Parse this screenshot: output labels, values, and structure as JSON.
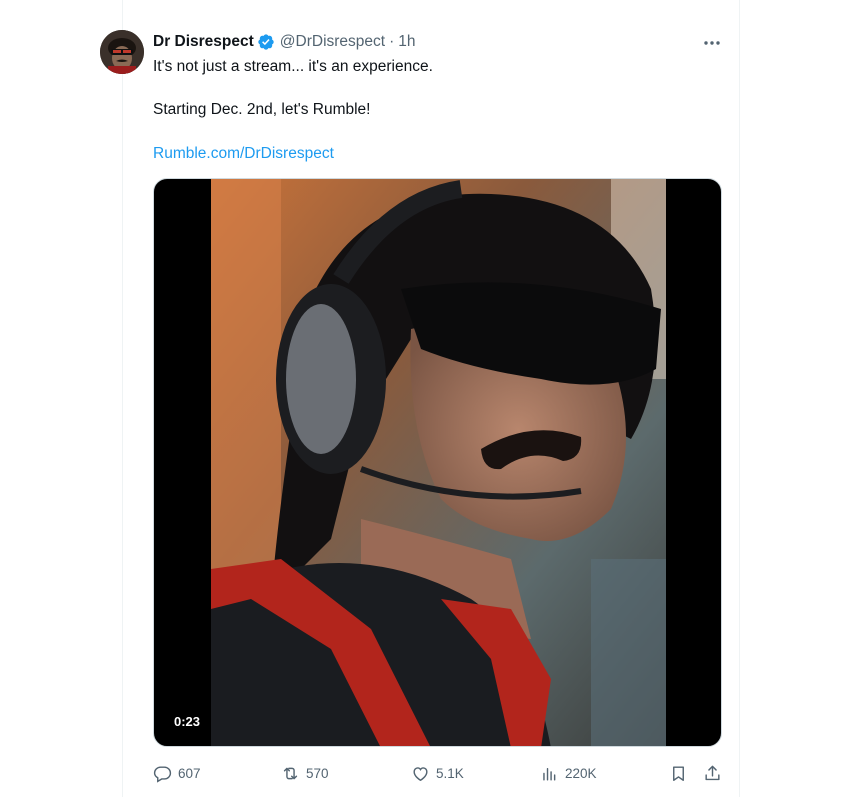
{
  "tweet": {
    "author_name": "Dr Disrespect",
    "handle": "@DrDisrespect",
    "separator": "·",
    "time": "1h",
    "text_line1": "It's not just a stream... it's an experience.",
    "text_line2": "Starting Dec. 2nd, let's Rumble!",
    "link_text": "Rumble.com/DrDisrespect"
  },
  "media": {
    "duration": "0:23"
  },
  "actions": {
    "replies": "607",
    "reposts": "570",
    "likes": "5.1K",
    "views": "220K"
  },
  "icons": {
    "verified": "verified-badge-icon",
    "more": "more-options-icon",
    "reply": "reply-icon",
    "repost": "repost-icon",
    "like": "heart-icon",
    "views": "views-chart-icon",
    "bookmark": "bookmark-icon",
    "share": "share-icon"
  },
  "colors": {
    "link": "#1d9bf0",
    "verified": "#1d9bf0",
    "secondary_text": "#536471",
    "primary_text": "#0f1419"
  }
}
